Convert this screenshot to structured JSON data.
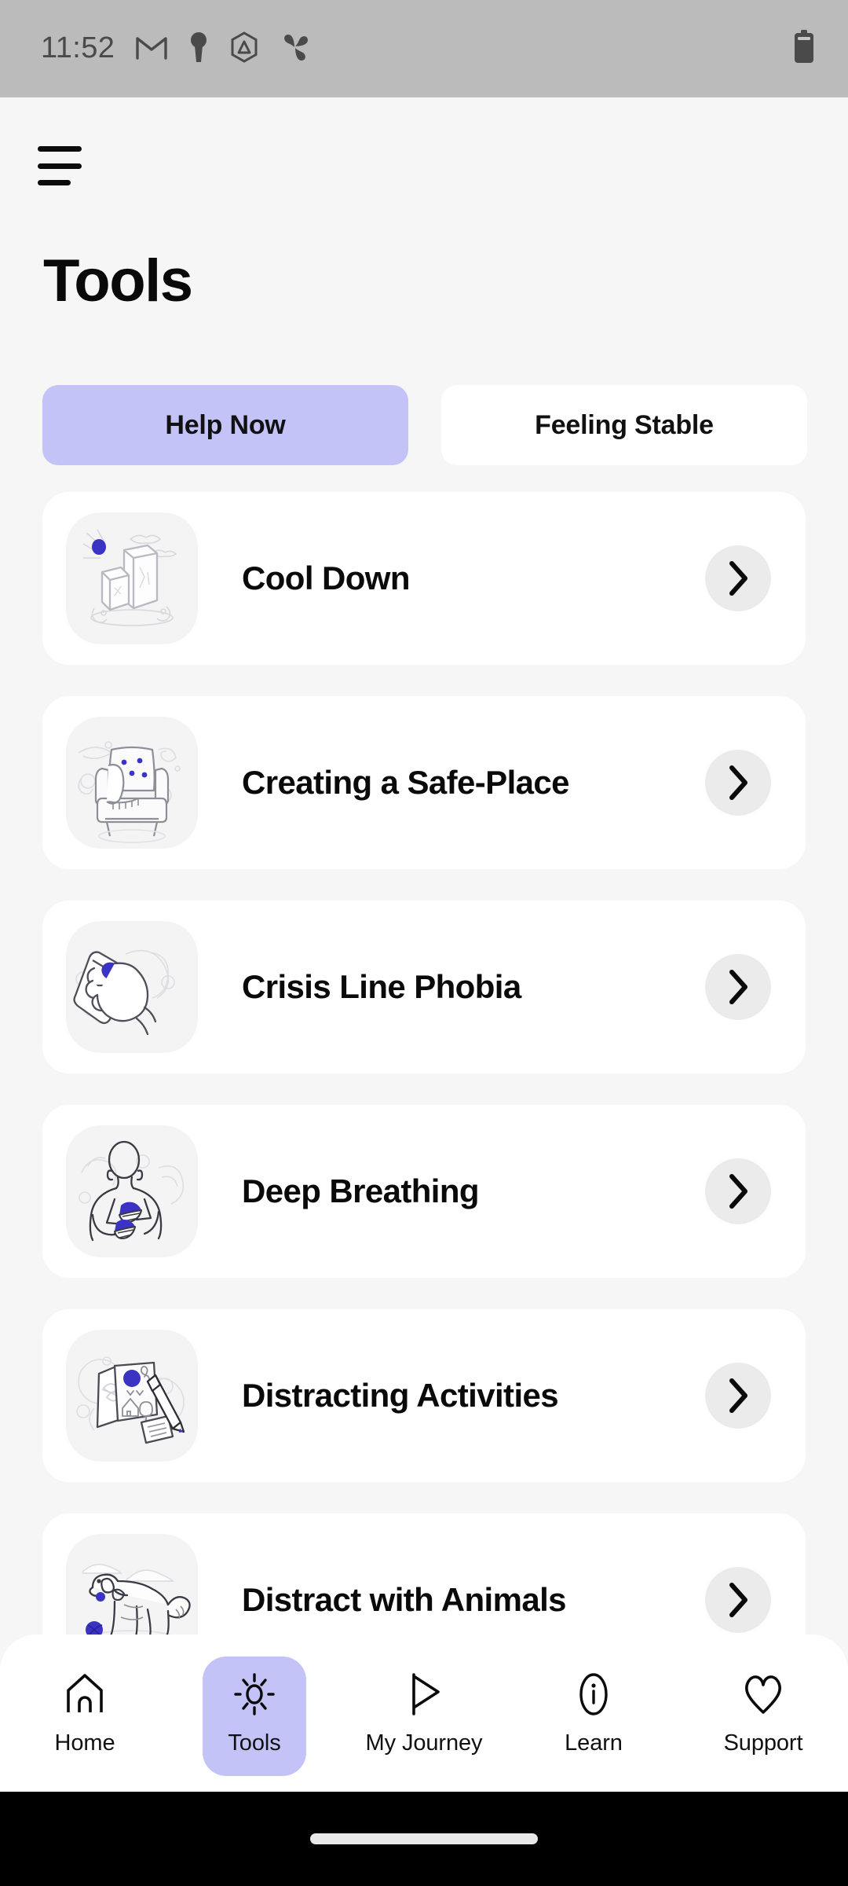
{
  "statusbar": {
    "time": "11:52",
    "icons": [
      "gmail-icon",
      "key-icon",
      "triangle-hexagon-icon",
      "pinwheel-icon"
    ],
    "battery": "battery-icon",
    "background": "#BBBBBB"
  },
  "header": {
    "menu": "hamburger-menu-icon",
    "title": "Tools"
  },
  "tabs": {
    "active_index": 0,
    "active_color": "#C4C3F8",
    "inactive_color": "#FFFFFF",
    "items": [
      {
        "label": "Help Now"
      },
      {
        "label": "Feeling Stable"
      }
    ]
  },
  "tools": {
    "accent": "#3B33C4",
    "card_background": "#FFFFFF",
    "thumb_background": "#F4F4F5",
    "chevron_circle": "#EBEBEB",
    "items": [
      {
        "label": "Cool Down",
        "illustration": "ice-cubes-illustration",
        "chevron": "chevron-right-icon"
      },
      {
        "label": "Creating a Safe-Place",
        "illustration": "armchair-illustration",
        "chevron": "chevron-right-icon"
      },
      {
        "label": "Crisis Line Phobia",
        "illustration": "hand-phone-illustration",
        "chevron": "chevron-right-icon"
      },
      {
        "label": "Deep Breathing",
        "illustration": "breathing-person-illustration",
        "chevron": "chevron-right-icon"
      },
      {
        "label": "Distracting Activities",
        "illustration": "drawing-pencil-illustration",
        "chevron": "chevron-right-icon"
      },
      {
        "label": "Distract with Animals",
        "illustration": "dog-ball-illustration",
        "chevron": "chevron-right-icon"
      }
    ]
  },
  "bottomnav": {
    "active_index": 1,
    "active_pill_color": "#C4C3F8",
    "items": [
      {
        "label": "Home",
        "icon": "home-icon"
      },
      {
        "label": "Tools",
        "icon": "brightness-sun-icon"
      },
      {
        "label": "My Journey",
        "icon": "play-flag-icon"
      },
      {
        "label": "Learn",
        "icon": "info-circle-icon"
      },
      {
        "label": "Support",
        "icon": "heart-icon"
      }
    ]
  },
  "gesture_bar": {
    "background": "#000000",
    "pill_color": "#E9E9E9"
  }
}
